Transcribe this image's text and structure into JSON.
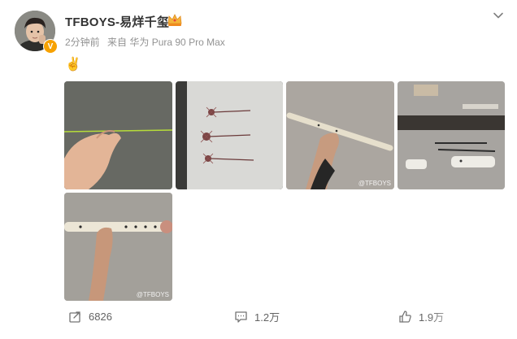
{
  "user": {
    "name": "TFBOYS-易烊千玺",
    "time": "2分钟前",
    "source": "来自 华为 Pura 90 Pro Max"
  },
  "post": {
    "emoji": "✌"
  },
  "images": [
    {
      "label": "hand-with-thread",
      "watermark": ""
    },
    {
      "label": "pressed-flowers-on-cloth",
      "watermark": ""
    },
    {
      "label": "holding-bamboo-flute",
      "watermark": "@TFBOYS"
    },
    {
      "label": "tools-and-materials",
      "watermark": ""
    },
    {
      "label": "finished-flute-in-hand",
      "watermark": "@TFBOYS"
    }
  ],
  "actions": {
    "share_count": "6826",
    "comment_count": "1.2万",
    "like_count": "1.9万"
  },
  "colors": {
    "verified": "#f7a100",
    "meta_text": "#939393",
    "action_text": "#636363"
  }
}
